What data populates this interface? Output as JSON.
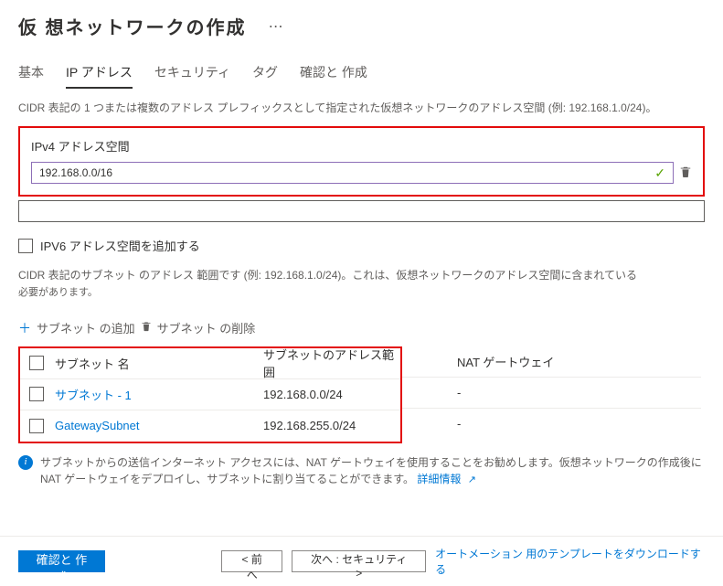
{
  "header": {
    "title": "仮 想ネットワークの作成"
  },
  "tabs": {
    "basic": "基本",
    "ip": "IP アドレス",
    "security": "セキュリティ",
    "tags": "タグ",
    "review": "確認と 作成"
  },
  "desc": "CIDR 表記の 1 つまたは複数のアドレス プレフィックスとして指定された仮想ネットワークのアドレス空間 (例: 192.168.1.0/24)。",
  "ipv4": {
    "label": "IPv4 アドレス空間",
    "value": "192.168.0.0/16"
  },
  "ipv6": {
    "label": "IPV6 アドレス空間を追加する"
  },
  "subnet_desc": {
    "line1": "CIDR  表記のサブネット のアドレス 範囲です  (例:  192.168.1.0/24)。これは、仮想ネットワークのアドレス空間に含まれている",
    "line2": "必要があります。"
  },
  "subnet_actions": {
    "add": "サブネット の追加",
    "delete": "サブネット の削除"
  },
  "table": {
    "headers": {
      "name": "サブネット 名",
      "range": "サブネットのアドレス範囲",
      "nat": "NAT ゲートウェイ"
    },
    "rows": [
      {
        "name": "サブネット - 1",
        "range": "192.168.0.0/24",
        "nat": "-"
      },
      {
        "name": "GatewaySubnet",
        "range": "192.168.255.0/24",
        "nat": "-"
      }
    ]
  },
  "info": {
    "text": "サブネットからの送信インターネット アクセスには、NAT ゲートウェイを使用することをお勧めします。仮想ネットワークの作成後に NAT ゲートウェイをデプロイし、サブネットに割り当てることができます。",
    "link": "詳細情報"
  },
  "footer": {
    "review": "確認と 作成",
    "prev": "<  前へ",
    "next": "次へ :  セキュリティ  >",
    "download": "オートメーション 用のテンプレートをダウンロードする"
  }
}
